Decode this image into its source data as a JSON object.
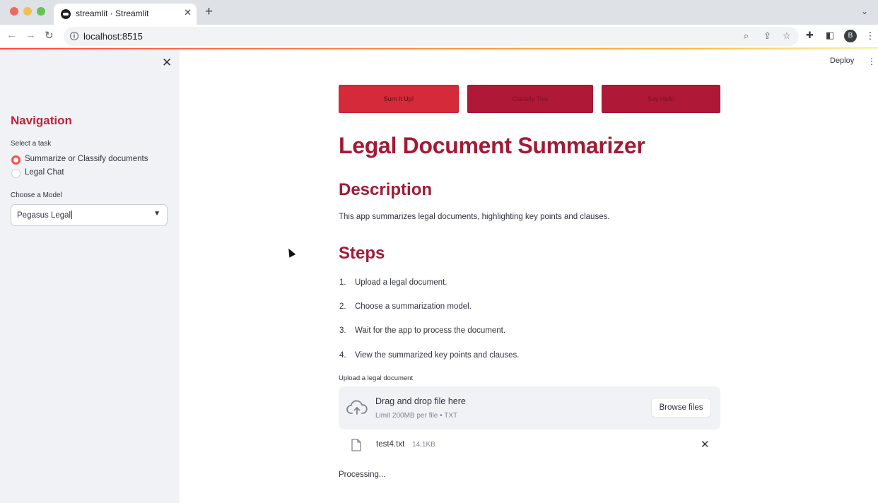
{
  "browser": {
    "tab_title": "streamlit · Streamlit",
    "url": "localhost:8515",
    "profile_initial": "B"
  },
  "sidebar": {
    "title": "Navigation",
    "task_label": "Select a task",
    "tasks": [
      {
        "label": "Summarize or Classify documents",
        "selected": true
      },
      {
        "label": "Legal Chat",
        "selected": false
      }
    ],
    "model_label": "Choose a Model",
    "model_value": "Pegasus Legal"
  },
  "header": {
    "deploy_label": "Deploy"
  },
  "main": {
    "buttons": [
      "Sum It Up!",
      "Classify This",
      "Say Hello"
    ],
    "title": "Legal Document Summarizer",
    "description_heading": "Description",
    "description_text": "This app summarizes legal documents, highlighting key points and clauses.",
    "steps_heading": "Steps",
    "steps": [
      {
        "num": "1.",
        "text": "Upload a legal document."
      },
      {
        "num": "2.",
        "text": "Choose a summarization model."
      },
      {
        "num": "3.",
        "text": "Wait for the app to process the document."
      },
      {
        "num": "4.",
        "text": "View the summarized key points and clauses."
      }
    ],
    "uploader": {
      "label": "Upload a legal document",
      "drop_text": "Drag and drop file here",
      "limit_text": "Limit 200MB per file • TXT",
      "browse_label": "Browse files"
    },
    "file": {
      "name": "test4.txt",
      "size": "14.1KB"
    },
    "status": "Processing..."
  },
  "colors": {
    "accent": "#ff4b4b",
    "heading": "#a31a34",
    "button_primary": "#d52a3a",
    "button_secondary": "#b01837"
  }
}
